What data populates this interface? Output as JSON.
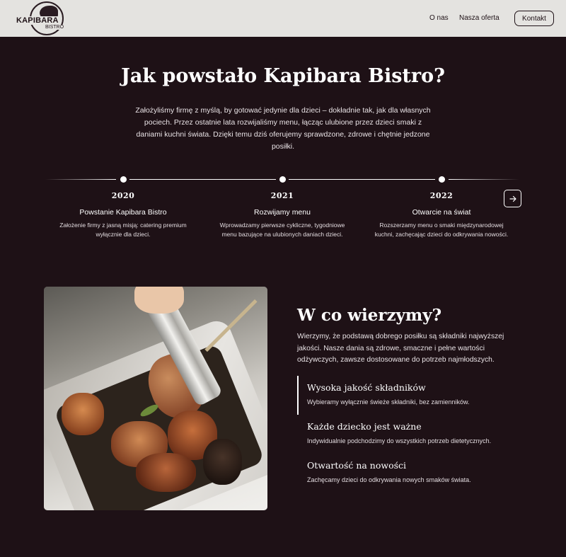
{
  "header": {
    "logo_text": "KAPIBARA",
    "logo_sub": "BISTRO",
    "nav": [
      "O nas",
      "Nasza oferta"
    ],
    "contact_label": "Kontakt"
  },
  "hero": {
    "title": "Jak powstało Kapibara Bistro?",
    "text": "Założyliśmy firmę z myślą, by gotować jedynie dla dzieci – dokładnie tak, jak dla własnych pociech. Przez ostatnie lata rozwijaliśmy menu, łącząc ulubione przez dzieci smaki z daniami kuchni świata. Dzięki temu dziś oferujemy sprawdzone, zdrowe i chętnie jedzone posiłki."
  },
  "timeline": {
    "items": [
      {
        "year": "2020",
        "title": "Powstanie Kapibara Bistro",
        "desc": "Założenie firmy z jasną misją: catering premium wyłącznie dla dzieci."
      },
      {
        "year": "2021",
        "title": "Rozwijamy menu",
        "desc": "Wprowadzamy pierwsze cykliczne, tygodniowe menu bazujące na ulubionych daniach dzieci."
      },
      {
        "year": "2022",
        "title": "Otwarcie na świat",
        "desc": "Rozszerzamy menu o smaki międzynarodowej kuchni, zachęcając dzieci do odkrywania nowości."
      }
    ],
    "next_icon": "arrow-right-icon"
  },
  "beliefs": {
    "title": "W co wierzymy?",
    "text": "Wierzymy, że podstawą dobrego posiłku są składniki najwyższej jakości. Nasze dania są zdrowe, smaczne i pełne wartości odżywczych, zawsze dostosowane do potrzeb najmłodszych.",
    "items": [
      {
        "title": "Wysoka jakość składników",
        "desc": "Wybieramy wyłącznie świeże składniki, bez zamienników."
      },
      {
        "title": "Każde dziecko jest ważne",
        "desc": "Indywidualnie podchodzimy do wszystkich potrzeb dietetycznych."
      },
      {
        "title": "Otwartość na nowości",
        "desc": "Zachęcamy dzieci do odkrywania nowych smaków świata."
      }
    ]
  },
  "colors": {
    "background": "#1e1116",
    "header": "#e4e3e0",
    "text": "#ffffff"
  }
}
